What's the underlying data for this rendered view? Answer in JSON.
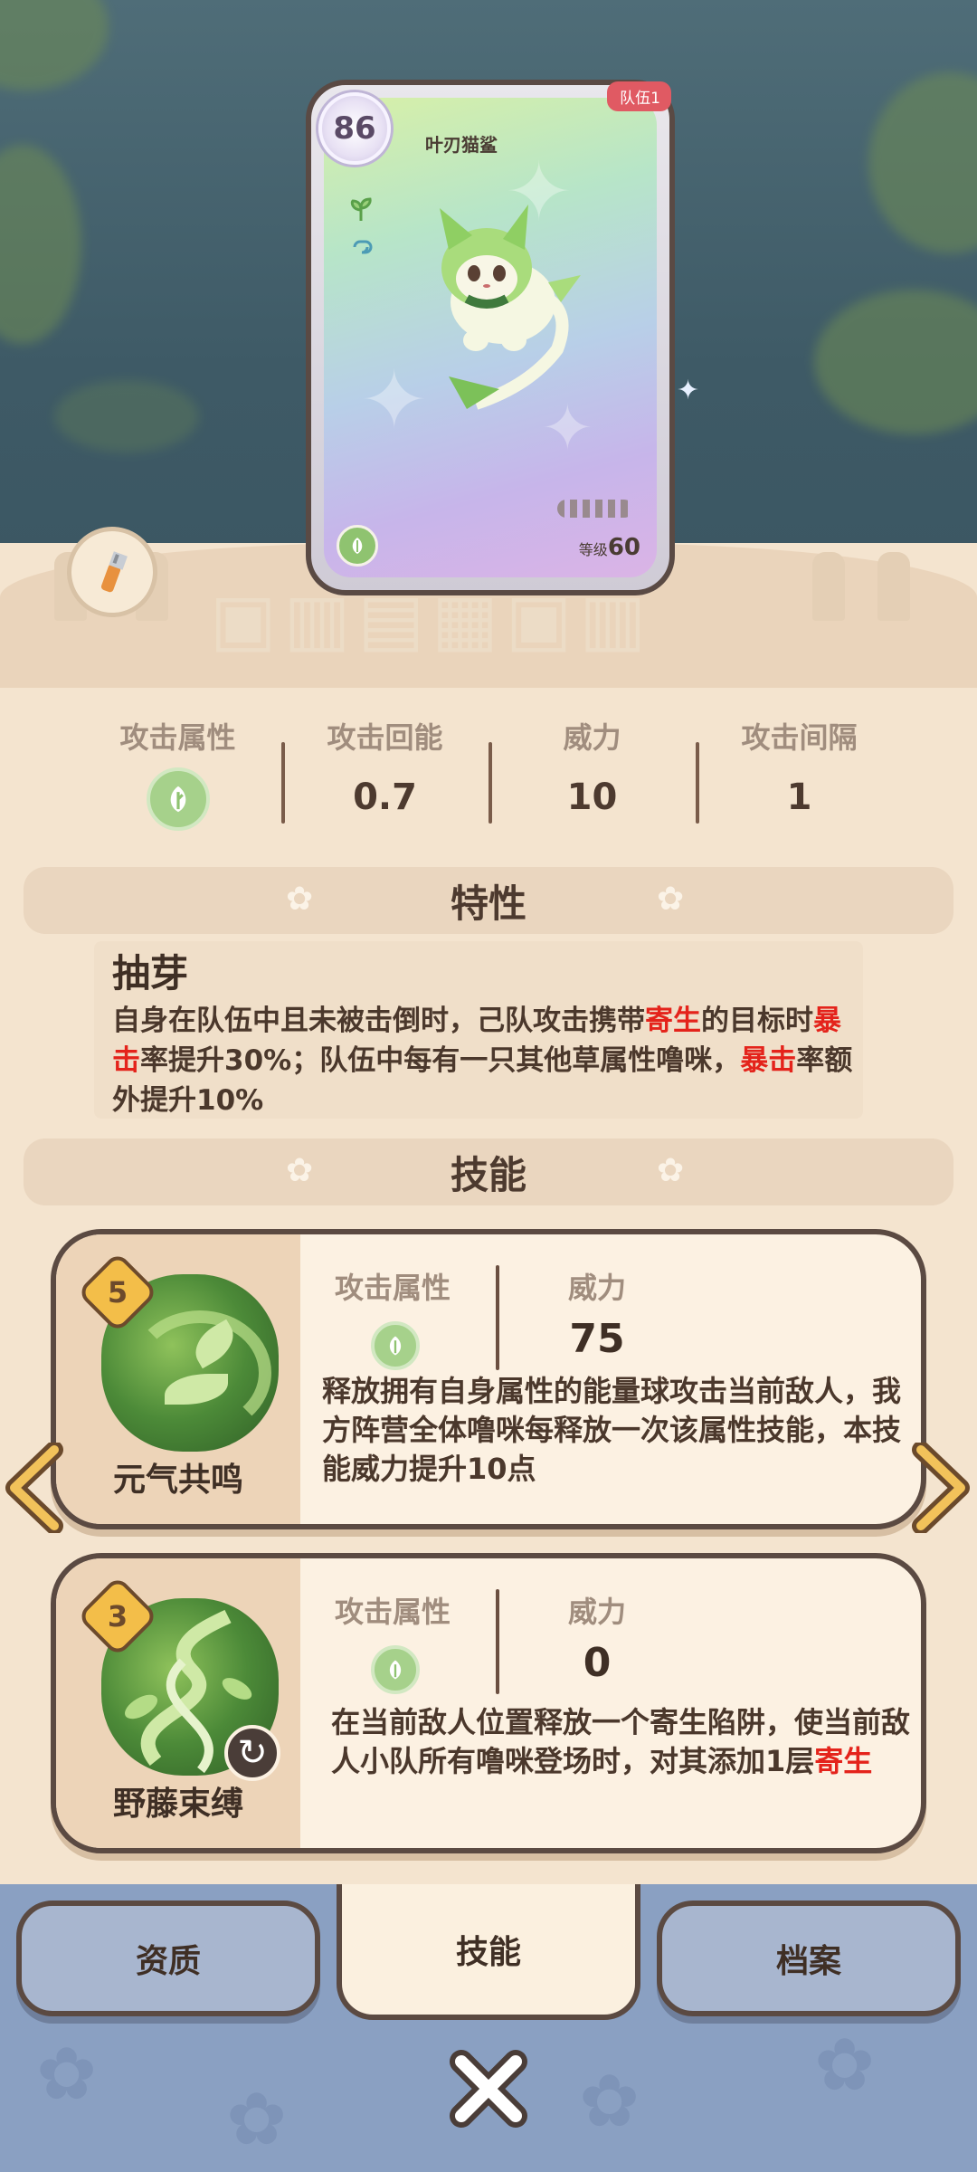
{
  "card": {
    "power": "86",
    "name": "叶刃猫鲨",
    "team_tag": "队伍1",
    "level_label": "等级",
    "level_value": "60"
  },
  "stats": {
    "labels": [
      "攻击属性",
      "攻击回能",
      "威力",
      "攻击间隔"
    ],
    "energy_regen": "0.7",
    "power": "10",
    "interval": "1"
  },
  "trait_section": {
    "header": "特性",
    "title": "抽芽",
    "desc_parts": [
      "自身在队伍中且未被击倒时，己队攻击携带",
      "寄生",
      "的目标时",
      "暴击",
      "率提升30%；队伍中每有一只其他草属性噜咪，",
      "暴击",
      "率额外提升10%"
    ]
  },
  "skill_section": {
    "header": "技能"
  },
  "skills": [
    {
      "name": "元气共鸣",
      "level": "5",
      "attr_label": "攻击属性",
      "power_label": "威力",
      "power": "75",
      "desc": "释放拥有自身属性的能量球攻击当前敌人，我方阵营全体噜咪每释放一次该属性技能，本技能威力提升10点"
    },
    {
      "name": "野藤束缚",
      "level": "3",
      "attr_label": "攻击属性",
      "power_label": "威力",
      "power": "0",
      "desc_parts": [
        "在当前敌人位置释放一个寄生陷阱，使当前敌人小队所有噜咪登场时，对其添加1层",
        "寄生"
      ]
    }
  ],
  "tabs": {
    "aptitude": "资质",
    "skills": "技能",
    "archive": "档案"
  },
  "colors": {
    "highlight": "#e4231b",
    "grass_element": "#a6d18b",
    "team_tag": "#e05a63",
    "panel_bg": "#f4e4cf",
    "bottom_bg": "#8aa0c2"
  },
  "icons": [
    "wrench-icon",
    "grass-element-icon",
    "paw-icon",
    "chevron-left-icon",
    "chevron-right-icon",
    "cooldown-icon",
    "close-icon",
    "sparkle-icon"
  ]
}
